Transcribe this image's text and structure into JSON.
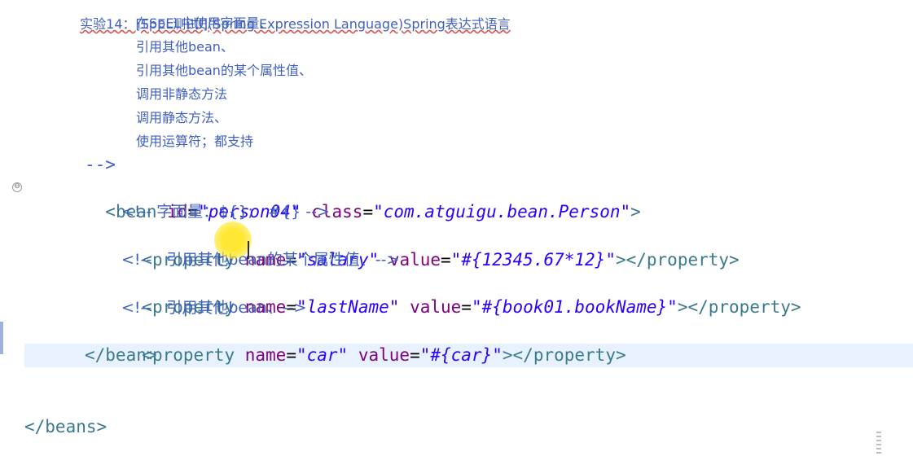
{
  "editor": {
    "header_comment": "实验14：[SpEL测试I](Spring Expression Language)Spring表达式语言",
    "comment_items": [
      "在SpEL中使用字面量、",
      "引用其他bean、",
      "引用其他bean的某个属性值、",
      "调用非静态方法",
      "调用静态方法、",
      "使用运算符；都支持"
    ],
    "comment_close": "-->",
    "bean_open": {
      "tag_start": "<bean",
      "id_attr": "id",
      "id_value": "\"person04\"",
      "class_attr": "class",
      "class_value": "\"com.atguigu.bean.Person\"",
      "tag_end": ">"
    },
    "comment1": "<!-- 字面量：${};   #{} -->",
    "property1": {
      "tag_start": "<property",
      "name_attr": "name",
      "name_value": "\"salary\"",
      "value_attr": "value",
      "value_value": "\"#{12345.67*12}\"",
      "tag_end": "></property>"
    },
    "comment2": "<!--   引用其他bean的某个属性值、-->",
    "property2": {
      "tag_start": "<property",
      "name_attr": "name",
      "name_value": "\"lastName\"",
      "value_attr": "value",
      "value_value": "\"#{book01.bookName}\"",
      "tag_end": "></property>"
    },
    "comment3": "<!--   引用其他bean、-->",
    "property3": {
      "tag_start": "<property",
      "name_attr": "name",
      "name_value": "\"car\"",
      "value_attr": "value",
      "value_value": "\"#{car}\"",
      "tag_end": "></property>"
    },
    "bean_close": "</bean>",
    "beans_close": "</beans>",
    "fold_symbol": "⊖"
  }
}
